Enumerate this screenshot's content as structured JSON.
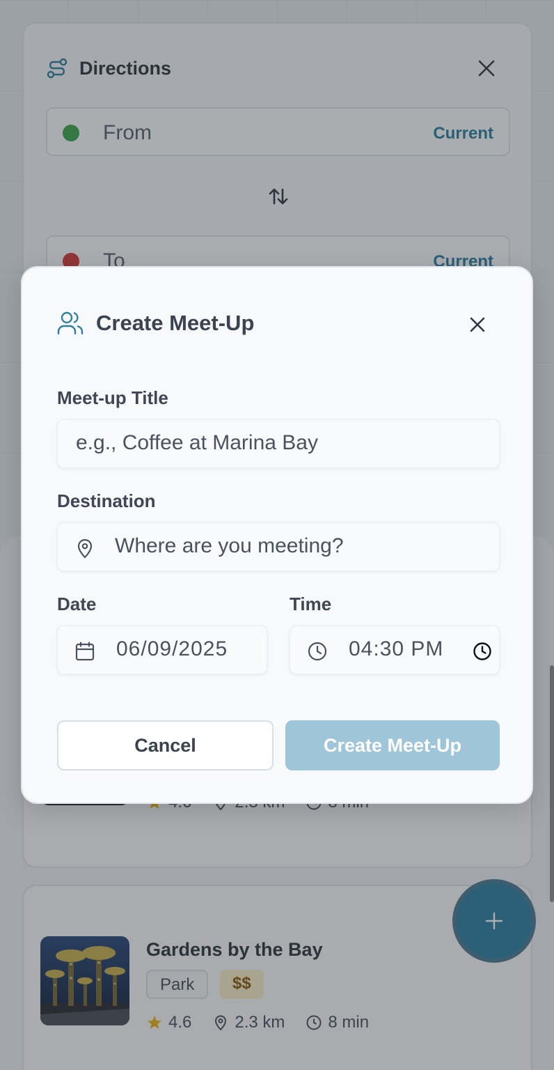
{
  "directions": {
    "title": "Directions",
    "from_placeholder": "From",
    "to_placeholder": "To",
    "current_label": "Current",
    "from_dot_color": "#3aa64c",
    "to_dot_color": "#d23b3b"
  },
  "places": [
    {
      "name": "",
      "rating": "4.6",
      "distance": "2.3 km",
      "time": "8 min"
    },
    {
      "name": "Gardens by the Bay",
      "category": "Park",
      "price": "$$",
      "rating": "4.6",
      "distance": "2.3 km",
      "time": "8 min"
    }
  ],
  "modal": {
    "title": "Create Meet-Up",
    "title_label": "Meet-up Title",
    "title_placeholder": "e.g., Coffee at Marina Bay",
    "destination_label": "Destination",
    "destination_placeholder": "Where are you meeting?",
    "date_label": "Date",
    "date_value": "06/09/2025",
    "time_label": "Time",
    "time_value": "04:30 PM",
    "cancel_label": "Cancel",
    "create_label": "Create Meet-Up"
  },
  "colors": {
    "accent": "#2e7ea1",
    "create_button": "#9fc5d8",
    "star": "#e7b416"
  }
}
